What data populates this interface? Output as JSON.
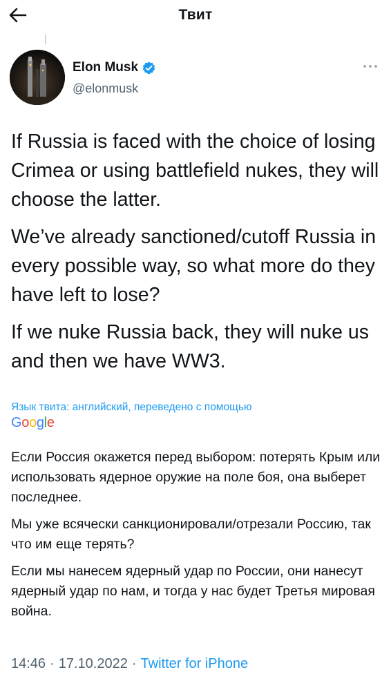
{
  "header": {
    "title": "Твит",
    "back_icon": "arrow-left-icon"
  },
  "author": {
    "name": "Elon Musk",
    "handle": "@elonmusk",
    "verified_icon": "verified-badge-icon",
    "more_icon": "more-horizontal-icon"
  },
  "tweet": {
    "paragraphs": [
      "If Russia is faced with the choice of losing Crimea or using battlefield nukes, they will choose the latter.",
      "We’ve already sanctioned/cutoff Russia in every possible way, so what more do they have left to lose?",
      "If we nuke Russia back, they will nuke us and then we have WW3."
    ]
  },
  "translation": {
    "label": "Язык твита: английский, переведено с помощью",
    "provider": "Google",
    "paragraphs": [
      "Если Россия окажется перед выбором: потерять Крым или использовать ядерное оружие на поле боя, она выберет последнее.",
      "Мы уже всячески санкционировали/отрезали Россию, так что им еще терять?",
      "Если мы нанесем ядерный удар по России, они нанесут ядерный удар по нам, и тогда у нас будет Третья мировая война."
    ]
  },
  "meta": {
    "time": "14:46",
    "separator": "·",
    "date": "17.10.2022",
    "source": "Twitter for iPhone"
  },
  "colors": {
    "accent": "#1d9bf0",
    "secondary_text": "#536471",
    "primary_text": "#0f1419",
    "google_blue": "#4285F4",
    "google_red": "#EA4335",
    "google_yellow": "#FBBC05",
    "google_green": "#34A853"
  }
}
